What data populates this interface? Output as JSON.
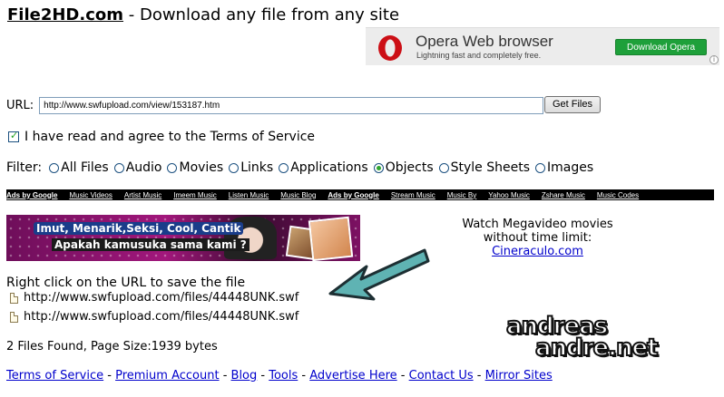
{
  "header": {
    "brand": "File2HD.com",
    "tagline": " - Download any file from any site"
  },
  "opera_ad": {
    "title": "Opera Web browser",
    "tagline": "Lightning fast and completely free.",
    "button": "Download Opera",
    "info": "i",
    "colors": {
      "button": "#1ea03a",
      "logo": "#cc0f16"
    }
  },
  "form": {
    "url_label": "URL:",
    "url_value": "http://www.swfupload.com/view/153187.htm",
    "get_button": "Get Files",
    "agree_label": "I have read and agree to the Terms of Service",
    "agree_checked": true
  },
  "filter": {
    "label": "Filter:",
    "options": [
      {
        "label": "All Files",
        "selected": false
      },
      {
        "label": "Audio",
        "selected": false
      },
      {
        "label": "Movies",
        "selected": false
      },
      {
        "label": "Links",
        "selected": false
      },
      {
        "label": "Applications",
        "selected": false
      },
      {
        "label": "Objects",
        "selected": true
      },
      {
        "label": "Style Sheets",
        "selected": false
      },
      {
        "label": "Images",
        "selected": false
      }
    ]
  },
  "ads_bar": {
    "group1": {
      "head": "Ads by Google",
      "links": [
        "Music Videos",
        "Artist Music",
        "Imeem Music",
        "Listen Music",
        "Music Blog"
      ]
    },
    "group2": {
      "head": "Ads by Google",
      "links": [
        "Stream Music",
        "Music By",
        "Yahoo Music",
        "Zshare Music",
        "Music Codes"
      ]
    }
  },
  "banner": {
    "line1": "Imut, Menarik,Seksi, Cool, Cantik",
    "line2": "Apakah kamusuka sama kami ?"
  },
  "megavideo": {
    "text1": "Watch Megavideo movies",
    "text2": "without time limit:",
    "link": "Cineraculo.com"
  },
  "results": {
    "title": "Right click on the URL to save the file",
    "files": [
      "http://www.swfupload.com/files/44448UNK.swf",
      "http://www.swfupload.com/files/44448UNK.swf"
    ],
    "summary": "2 Files Found, Page Size:1939 bytes"
  },
  "watermark": {
    "line1": "andreas",
    "line2": "andre.net"
  },
  "footer": {
    "links": [
      "Terms of Service",
      "Premium Account",
      "Blog",
      "Tools",
      "Advertise Here",
      "Contact Us",
      "Mirror Sites"
    ],
    "separator": " - "
  }
}
